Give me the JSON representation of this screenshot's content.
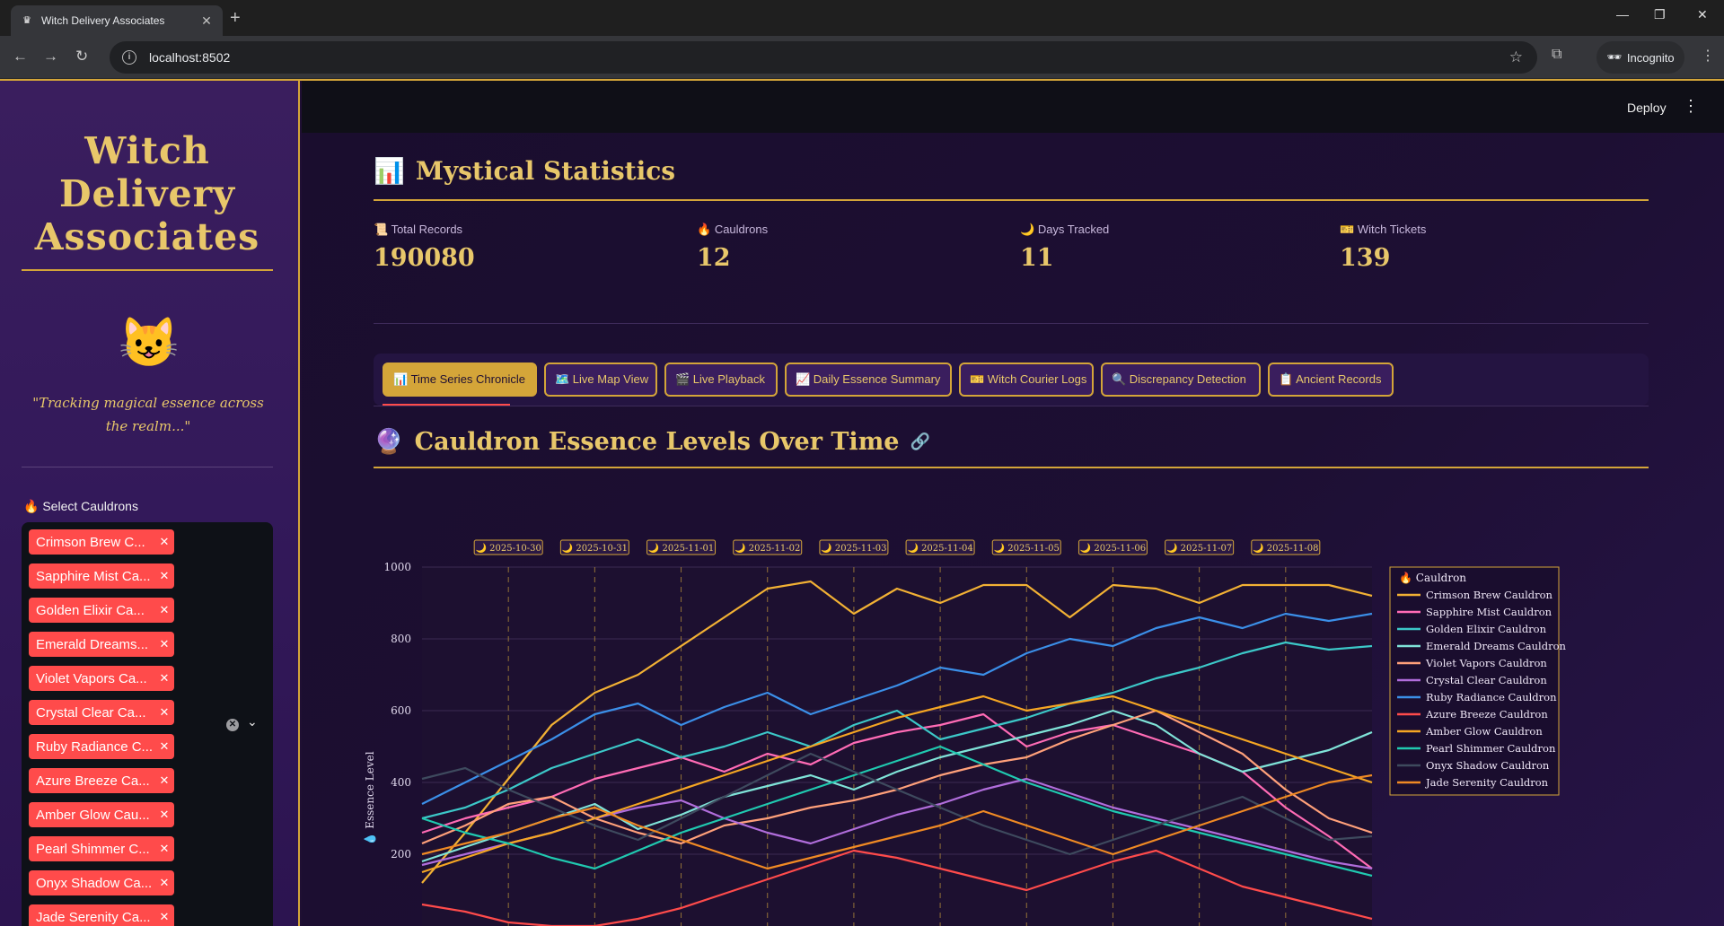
{
  "browser": {
    "tab_title": "Witch Delivery Associates",
    "url": "localhost:8502",
    "profile_label": "Incognito"
  },
  "app_header": {
    "deploy_label": "Deploy"
  },
  "sidebar": {
    "brand_line1": "Witch",
    "brand_line2": "Delivery",
    "brand_line3": "Associates",
    "mascot": "😺",
    "tagline_line1": "\"Tracking magical essence across",
    "tagline_line2": "the realm...\"",
    "select_label": "Select Cauldrons",
    "selected_chips": [
      "Crimson Brew C...",
      "Sapphire Mist Ca...",
      "Golden Elixir Ca...",
      "Emerald Dreams...",
      "Violet Vapors Ca...",
      "Crystal Clear Ca...",
      "Ruby Radiance C...",
      "Azure Breeze Ca...",
      "Amber Glow Cau...",
      "Pearl Shimmer C...",
      "Onyx Shadow Ca...",
      "Jade Serenity Ca..."
    ]
  },
  "stats": {
    "title": "Mystical Statistics",
    "metrics": [
      {
        "icon": "📜",
        "label": "Total Records",
        "value": "190080"
      },
      {
        "icon": "🔥",
        "label": "Cauldrons",
        "value": "12"
      },
      {
        "icon": "🌙",
        "label": "Days Tracked",
        "value": "11"
      },
      {
        "icon": "🎫",
        "label": "Witch Tickets",
        "value": "139"
      }
    ]
  },
  "tabs": [
    {
      "icon": "📊",
      "label": "Time Series Chronicle",
      "active": true
    },
    {
      "icon": "🗺️",
      "label": "Live Map View",
      "active": false
    },
    {
      "icon": "🎬",
      "label": "Live Playback",
      "active": false
    },
    {
      "icon": "📈",
      "label": "Daily Essence Summary",
      "active": false
    },
    {
      "icon": "🎫",
      "label": "Witch Courier Logs",
      "active": false
    },
    {
      "icon": "🔍",
      "label": "Discrepancy Detection",
      "active": false
    },
    {
      "icon": "📋",
      "label": "Ancient Records",
      "active": false
    }
  ],
  "chart_section": {
    "title": "Cauldron Essence Levels Over Time"
  },
  "chart_data": {
    "type": "line",
    "title": "",
    "ylabel": "💧 Essence Level",
    "xlabel": "",
    "ylim": [
      0,
      1000
    ],
    "yticks": [
      200,
      400,
      600,
      800,
      1000
    ],
    "grid": true,
    "legend_title": "🔥 Cauldron",
    "legend_position": "right",
    "day_markers": [
      "🌙 2025-10-30",
      "🌙 2025-10-31",
      "🌙 2025-11-01",
      "🌙 2025-11-02",
      "🌙 2025-11-03",
      "🌙 2025-11-04",
      "🌙 2025-11-05",
      "🌙 2025-11-06",
      "🌙 2025-11-07",
      "🌙 2025-11-08"
    ],
    "x_day_index": [
      0,
      0.5,
      1,
      1.5,
      2,
      2.5,
      3,
      3.5,
      4,
      4.5,
      5,
      5.5,
      6,
      6.5,
      7,
      7.5,
      8,
      8.5,
      9,
      9.5,
      10,
      10.5,
      11
    ],
    "series": [
      {
        "name": "Crimson Brew Cauldron",
        "color": "#f2b134",
        "values": [
          120,
          260,
          410,
          560,
          650,
          700,
          780,
          860,
          940,
          960,
          870,
          940,
          900,
          950,
          950,
          860,
          950,
          940,
          900,
          950,
          950,
          950,
          920
        ]
      },
      {
        "name": "Sapphire Mist Cauldron",
        "color": "#ff6bb5",
        "values": [
          260,
          300,
          330,
          360,
          410,
          440,
          470,
          430,
          480,
          450,
          510,
          540,
          560,
          590,
          500,
          540,
          560,
          520,
          480,
          430,
          330,
          250,
          160
        ]
      },
      {
        "name": "Golden Elixir Cauldron",
        "color": "#3cc8c8",
        "values": [
          300,
          330,
          380,
          440,
          480,
          520,
          470,
          500,
          540,
          500,
          560,
          600,
          520,
          550,
          580,
          620,
          650,
          690,
          720,
          760,
          790,
          770,
          780
        ]
      },
      {
        "name": "Emerald Dreams Cauldron",
        "color": "#7fe3d8",
        "values": [
          180,
          220,
          260,
          300,
          340,
          270,
          310,
          360,
          390,
          420,
          380,
          430,
          470,
          500,
          530,
          560,
          600,
          560,
          480,
          430,
          460,
          490,
          540
        ]
      },
      {
        "name": "Violet Vapors Cauldron",
        "color": "#ffa07a",
        "values": [
          230,
          280,
          340,
          360,
          300,
          260,
          230,
          280,
          300,
          330,
          350,
          380,
          420,
          450,
          470,
          520,
          560,
          600,
          540,
          480,
          380,
          300,
          260
        ]
      },
      {
        "name": "Crystal Clear Cauldron",
        "color": "#b06ddb",
        "values": [
          170,
          200,
          230,
          260,
          300,
          330,
          350,
          300,
          260,
          230,
          270,
          310,
          340,
          380,
          410,
          370,
          330,
          300,
          270,
          240,
          210,
          180,
          160
        ]
      },
      {
        "name": "Ruby Radiance Cauldron",
        "color": "#3b8fe8",
        "values": [
          340,
          400,
          460,
          520,
          590,
          620,
          560,
          610,
          650,
          590,
          630,
          670,
          720,
          700,
          760,
          800,
          780,
          830,
          860,
          830,
          870,
          850,
          870
        ]
      },
      {
        "name": "Azure Breeze Cauldron",
        "color": "#ff4b4b",
        "values": [
          60,
          40,
          10,
          0,
          0,
          20,
          50,
          90,
          130,
          170,
          210,
          190,
          160,
          130,
          100,
          140,
          180,
          210,
          160,
          110,
          80,
          50,
          20
        ]
      },
      {
        "name": "Amber Glow Cauldron",
        "color": "#f5a623",
        "values": [
          150,
          190,
          230,
          260,
          300,
          340,
          380,
          420,
          460,
          500,
          540,
          580,
          610,
          640,
          600,
          620,
          640,
          600,
          560,
          520,
          480,
          440,
          400
        ]
      },
      {
        "name": "Pearl Shimmer Cauldron",
        "color": "#20c9b0",
        "values": [
          300,
          260,
          230,
          190,
          160,
          210,
          260,
          300,
          340,
          380,
          420,
          460,
          500,
          450,
          400,
          360,
          320,
          290,
          260,
          230,
          200,
          170,
          140
        ]
      },
      {
        "name": "Onyx Shadow Cauldron",
        "color": "#3e4a5e",
        "values": [
          410,
          440,
          380,
          330,
          280,
          240,
          300,
          360,
          420,
          480,
          430,
          380,
          330,
          280,
          240,
          200,
          240,
          280,
          320,
          360,
          300,
          240,
          250
        ]
      },
      {
        "name": "Jade Serenity Cauldron",
        "color": "#f08a24",
        "values": [
          200,
          230,
          260,
          300,
          330,
          280,
          240,
          200,
          160,
          190,
          220,
          250,
          280,
          320,
          280,
          240,
          200,
          240,
          280,
          320,
          360,
          400,
          420
        ]
      }
    ]
  }
}
